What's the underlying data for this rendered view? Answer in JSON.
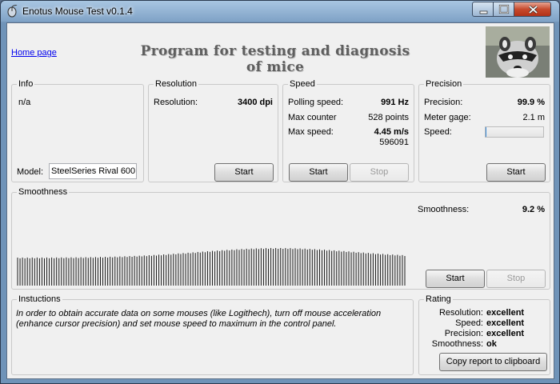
{
  "window": {
    "title": "Enotus Mouse Test v0.1.4"
  },
  "header": {
    "home_link": "Home page",
    "banner": "Program for testing and diagnosis of mice"
  },
  "info": {
    "legend": "Info",
    "text": "n/a",
    "model_label": "Model:",
    "model_value": "SteelSeries Rival 600"
  },
  "resolution": {
    "legend": "Resolution",
    "label": "Resolution:",
    "value": "3400 dpi",
    "start": "Start"
  },
  "speed": {
    "legend": "Speed",
    "polling_label": "Polling speed:",
    "polling_value": "991 Hz",
    "counter_label": "Max counter",
    "counter_value": "528 points",
    "maxspeed_label": "Max  speed:",
    "maxspeed_value": "4.45 m/s",
    "raw_value": "596091",
    "start": "Start",
    "stop": "Stop"
  },
  "precision": {
    "legend": "Precision",
    "precision_label": "Precision:",
    "precision_value": "99.9 %",
    "gage_label": "Meter gage:",
    "gage_value": "2.1 m",
    "speed_label": "Speed:",
    "speed_level": 0.02,
    "start": "Start"
  },
  "smoothness": {
    "legend": "Smoothness",
    "label": "Smoothness:",
    "value": "9.2 %",
    "start": "Start",
    "stop": "Stop",
    "bar_color": "#1a1a1a"
  },
  "instructions": {
    "legend": "Instuctions",
    "text": "In order to obtain accurate data on some mouses (like Logithech), turn off mouse acceleration (enhance cursor precision) and set mouse speed to maximum in the control panel."
  },
  "rating": {
    "legend": "Rating",
    "rows": [
      {
        "label": "Resolution:",
        "value": "excellent"
      },
      {
        "label": "Speed:",
        "value": "excellent"
      },
      {
        "label": "Precision:",
        "value": "excellent"
      },
      {
        "label": "Smoothness:",
        "value": "ok"
      }
    ],
    "copy": "Copy report to clipboard"
  }
}
